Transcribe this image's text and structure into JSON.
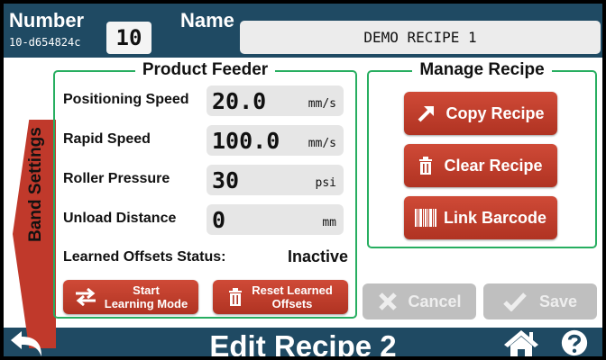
{
  "header": {
    "number_label": "Number",
    "number_value": "10",
    "recipe_id": "10-d654824c",
    "name_label": "Name",
    "name_value": "DEMO RECIPE 1"
  },
  "side_tab": {
    "label": "Band Settings"
  },
  "product_feeder": {
    "title": "Product Feeder",
    "fields": [
      {
        "label": "Positioning Speed",
        "value": "20.0",
        "unit": "mm/s"
      },
      {
        "label": "Rapid Speed",
        "value": "100.0",
        "unit": "mm/s"
      },
      {
        "label": "Roller Pressure",
        "value": "30",
        "unit": "psi"
      },
      {
        "label": "Unload Distance",
        "value": "0",
        "unit": "mm"
      }
    ],
    "offsets_status_label": "Learned Offsets Status:",
    "offsets_status_value": "Inactive",
    "start_learning_line1": "Start",
    "start_learning_line2": "Learning Mode",
    "reset_offsets_line1": "Reset Learned",
    "reset_offsets_line2": "Offsets"
  },
  "manage_recipe": {
    "title": "Manage Recipe",
    "copy_label": "Copy Recipe",
    "clear_label": "Clear Recipe",
    "barcode_label": "Link Barcode"
  },
  "actions": {
    "cancel_label": "Cancel",
    "save_label": "Save"
  },
  "footer": {
    "title": "Edit Recipe 2"
  },
  "colors": {
    "header_bg": "#1f4a63",
    "accent_red": "#c0392b",
    "group_border": "#27ae60",
    "disabled_gray": "#bfbfbf"
  },
  "icons": [
    "back-arrow-icon",
    "home-icon",
    "help-icon",
    "copy-arrow-icon",
    "trash-icon",
    "barcode-icon",
    "swap-arrows-icon",
    "x-icon",
    "check-icon"
  ]
}
